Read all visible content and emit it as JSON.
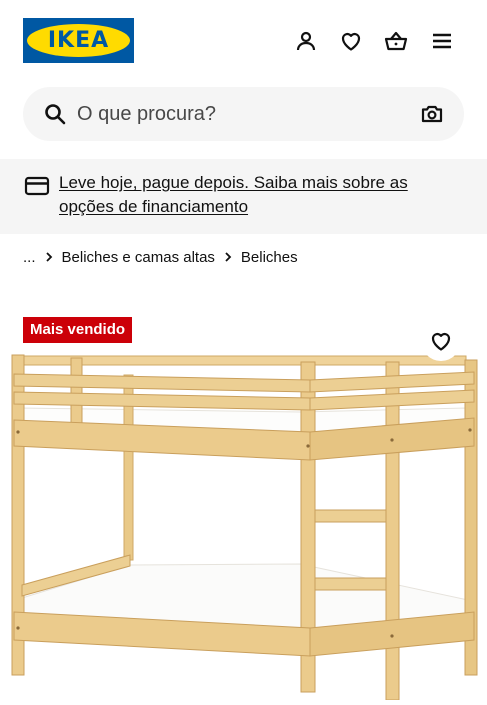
{
  "header": {
    "logo_text": "IKEA",
    "icons": [
      "user-icon",
      "heart-icon",
      "basket-icon",
      "menu-icon"
    ]
  },
  "search": {
    "placeholder": "O que procura?",
    "value": ""
  },
  "banner": {
    "icon": "credit-card-icon",
    "text": "Leve hoje, pague depois. Saiba mais sobre as opções de financiamento"
  },
  "breadcrumb": {
    "ellipsis": "...",
    "items": [
      "Beliches e camas altas",
      "Beliches"
    ]
  },
  "product": {
    "badge": "Mais vendido",
    "image": "bunk-bed-image"
  },
  "colors": {
    "brand_blue": "#0058a3",
    "brand_yellow": "#ffdb00",
    "badge_red": "#cc0008",
    "surface": "#f5f5f5"
  }
}
